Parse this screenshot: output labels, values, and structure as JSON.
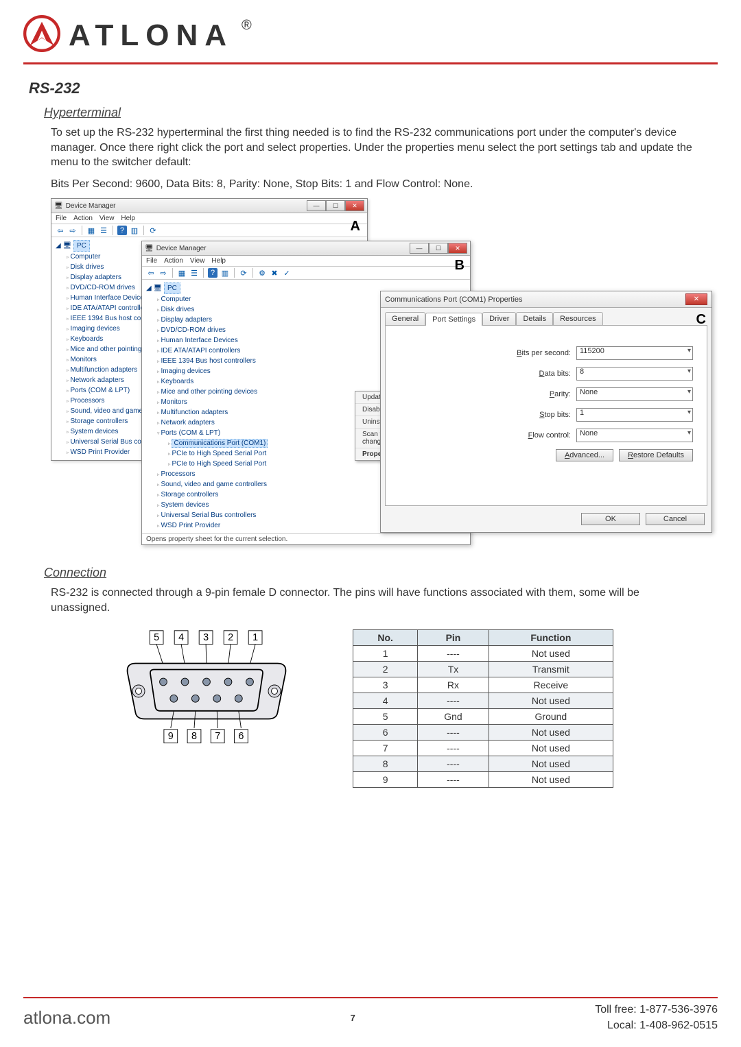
{
  "logo": {
    "brand": "ATLONA"
  },
  "heading": "RS-232",
  "subheading1": "Hyperterminal",
  "paragraph1": "To set up the RS-232 hyperterminal the first thing needed is to find the RS-232 communications port under the computer's device manager. Once there right click the port and select properties. Under the properties menu select the port settings tab and update the menu to the switcher default:",
  "paragraph2": "Bits Per Second: 9600, Data Bits: 8, Parity: None, Stop Bits: 1 and Flow Control: None.",
  "callouts": {
    "a": "A",
    "b": "B",
    "c": "C"
  },
  "devmgr": {
    "title": "Device Manager",
    "menus": [
      "File",
      "Action",
      "View",
      "Help"
    ],
    "root": "PC",
    "items": [
      "Computer",
      "Disk drives",
      "Display adapters",
      "DVD/CD-ROM drives",
      "Human Interface Devices",
      "IDE ATA/ATAPI controllers",
      "IEEE 1394 Bus host controllers",
      "Imaging devices",
      "Keyboards",
      "Mice and other pointing devices",
      "Monitors",
      "Multifunction adapters",
      "Network adapters",
      "Ports (COM & LPT)",
      "Processors",
      "Sound, video and game controllers",
      "Storage controllers",
      "System devices",
      "Universal Serial Bus controllers",
      "WSD Print Provider"
    ],
    "sub_ports": [
      "Communications Port (COM1)",
      "PCIe to High Speed Serial Port",
      "PCIe to High Speed Serial Port"
    ],
    "context_menu": [
      "Update Driver Software...",
      "Disable",
      "Uninstall",
      "Scan for hardware changes",
      "Properties"
    ],
    "status": "Opens property sheet for the current selection."
  },
  "dialog": {
    "title": "Communications Port (COM1) Properties",
    "tabs": [
      "General",
      "Port Settings",
      "Driver",
      "Details",
      "Resources"
    ],
    "active_tab": "Port Settings",
    "fields": {
      "bps_label": "Bits per second:",
      "bps_value": "115200",
      "databits_label": "Data bits:",
      "databits_value": "8",
      "parity_label": "Parity:",
      "parity_value": "None",
      "stopbits_label": "Stop bits:",
      "stopbits_value": "1",
      "flow_label": "Flow control:",
      "flow_value": "None"
    },
    "advanced_btn": "Advanced...",
    "restore_btn": "Restore Defaults",
    "ok": "OK",
    "cancel": "Cancel"
  },
  "subheading2": "Connection",
  "paragraph3": "RS-232 is connected through a 9-pin female D connector. The pins will have functions associated with them, some will be unassigned.",
  "pin_labels_top": [
    "5",
    "4",
    "3",
    "2",
    "1"
  ],
  "pin_labels_bottom": [
    "9",
    "8",
    "7",
    "6"
  ],
  "pin_table": {
    "headers": [
      "No.",
      "Pin",
      "Function"
    ],
    "rows": [
      {
        "no": "1",
        "pin": "----",
        "fn": "Not used"
      },
      {
        "no": "2",
        "pin": "Tx",
        "fn": "Transmit"
      },
      {
        "no": "3",
        "pin": "Rx",
        "fn": "Receive"
      },
      {
        "no": "4",
        "pin": "----",
        "fn": "Not used"
      },
      {
        "no": "5",
        "pin": "Gnd",
        "fn": "Ground"
      },
      {
        "no": "6",
        "pin": "----",
        "fn": "Not used"
      },
      {
        "no": "7",
        "pin": "----",
        "fn": "Not used"
      },
      {
        "no": "8",
        "pin": "----",
        "fn": "Not used"
      },
      {
        "no": "9",
        "pin": "----",
        "fn": "Not used"
      }
    ]
  },
  "footer": {
    "website": "atlona.com",
    "page": "7",
    "tollfree": "Toll free: 1-877-536-3976",
    "local": "Local: 1-408-962-0515"
  }
}
